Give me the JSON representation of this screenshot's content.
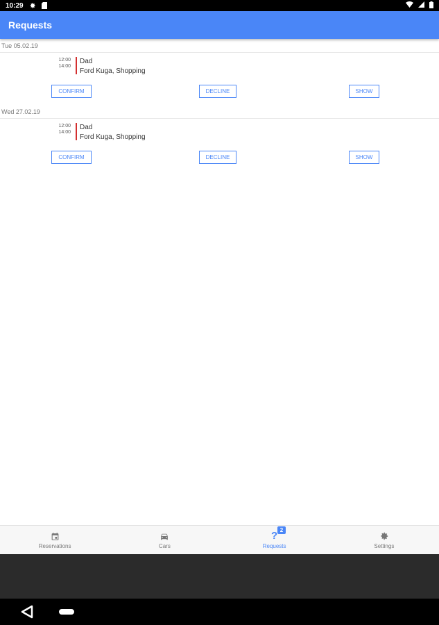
{
  "status_bar": {
    "time": "10:29",
    "icons_left": [
      "gear-icon",
      "sim-card-icon"
    ],
    "icons_right": [
      "wifi-icon",
      "signal-icon",
      "battery-icon"
    ]
  },
  "app_bar": {
    "title": "Requests",
    "color": "#4a86f7"
  },
  "days": [
    {
      "date": "Tue 05.02.19",
      "requests": [
        {
          "start": "12:00",
          "end": "14:00",
          "person": "Dad",
          "detail": "Ford Kuga, Shopping",
          "confirm_label": "CONFIRM",
          "decline_label": "DECLINE",
          "show_label": "SHOW"
        }
      ]
    },
    {
      "date": "Wed 27.02.19",
      "requests": [
        {
          "start": "12:00",
          "end": "14:00",
          "person": "Dad",
          "detail": "Ford Kuga, Shopping",
          "confirm_label": "CONFIRM",
          "decline_label": "DECLINE",
          "show_label": "SHOW"
        }
      ]
    }
  ],
  "bottom_nav": {
    "items": [
      {
        "label": "Reservations",
        "icon": "calendar-icon",
        "active": false
      },
      {
        "label": "Cars",
        "icon": "car-icon",
        "active": false
      },
      {
        "label": "Requests",
        "icon": "question-mark-icon",
        "active": true,
        "badge": "2"
      },
      {
        "label": "Settings",
        "icon": "gear-icon",
        "active": false
      }
    ]
  },
  "system_nav": {
    "buttons": [
      "back-icon",
      "home-pill-icon"
    ]
  },
  "colors": {
    "accent": "#4a86f7",
    "time_bar": "#d32f2f"
  }
}
